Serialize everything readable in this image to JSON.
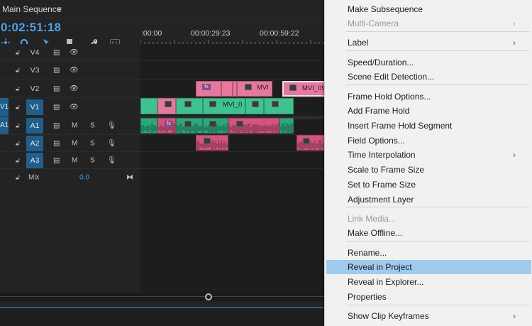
{
  "panel": {
    "title": "Main Sequence",
    "menu_icon": "hamburger-icon"
  },
  "timecode": "0:02:51:18",
  "ruler": {
    "labels": [
      ":00:00",
      "00:00:29:23",
      "00:00:59:22"
    ]
  },
  "tracks": {
    "video": [
      {
        "name": "V4",
        "targeted": false,
        "source_patch": ""
      },
      {
        "name": "V3",
        "targeted": false,
        "source_patch": ""
      },
      {
        "name": "V2",
        "targeted": false,
        "source_patch": ""
      },
      {
        "name": "V1",
        "targeted": true,
        "source_patch": "V1"
      }
    ],
    "audio": [
      {
        "name": "A1",
        "targeted": true,
        "source_patch": "A1",
        "mute": "M",
        "solo": "S"
      },
      {
        "name": "A2",
        "targeted": false,
        "source_patch": "",
        "mute": "M",
        "solo": "S"
      },
      {
        "name": "A3",
        "targeted": false,
        "source_patch": "",
        "mute": "M",
        "solo": "S"
      }
    ],
    "mix": {
      "label": "Mix",
      "value": "0.0"
    }
  },
  "clips": {
    "v2_label_1": "MVI",
    "v2_label_2": "MVI_09",
    "v1_label": "MVI_0"
  },
  "menu": {
    "items": [
      {
        "label": "Make Subsequence",
        "disabled": false,
        "submenu": false
      },
      {
        "label": "Multi-Camera",
        "disabled": true,
        "submenu": true
      },
      {
        "label": "Label",
        "disabled": false,
        "submenu": true
      },
      {
        "label": "Speed/Duration...",
        "disabled": false,
        "submenu": false
      },
      {
        "label": "Scene Edit Detection...",
        "disabled": false,
        "submenu": false
      },
      {
        "label": "Frame Hold Options...",
        "disabled": false,
        "submenu": false
      },
      {
        "label": "Add Frame Hold",
        "disabled": false,
        "submenu": false
      },
      {
        "label": "Insert Frame Hold Segment",
        "disabled": false,
        "submenu": false
      },
      {
        "label": "Field Options...",
        "disabled": false,
        "submenu": false
      },
      {
        "label": "Time Interpolation",
        "disabled": false,
        "submenu": true
      },
      {
        "label": "Scale to Frame Size",
        "disabled": false,
        "submenu": false
      },
      {
        "label": "Set to Frame Size",
        "disabled": false,
        "submenu": false
      },
      {
        "label": "Adjustment Layer",
        "disabled": false,
        "submenu": false
      },
      {
        "label": "Link Media...",
        "disabled": true,
        "submenu": false
      },
      {
        "label": "Make Offline...",
        "disabled": false,
        "submenu": false
      },
      {
        "label": "Rename...",
        "disabled": false,
        "submenu": false
      },
      {
        "label": "Reveal in Project",
        "disabled": false,
        "submenu": false,
        "highlighted": true
      },
      {
        "label": "Reveal in Explorer...",
        "disabled": false,
        "submenu": false
      },
      {
        "label": "Properties",
        "disabled": false,
        "submenu": false
      },
      {
        "label": "Show Clip Keyframes",
        "disabled": false,
        "submenu": true
      }
    ],
    "arrow": "›"
  },
  "colors": {
    "video_clip": "#e8779f",
    "v1_clip": "#3ec38e",
    "audio_a1_clip": "#2aa87a",
    "audio_clip": "#d8527f",
    "timecode": "#4d9fe8",
    "targeted": "#1e5f8c",
    "menu_highlight": "#9fcbef"
  }
}
